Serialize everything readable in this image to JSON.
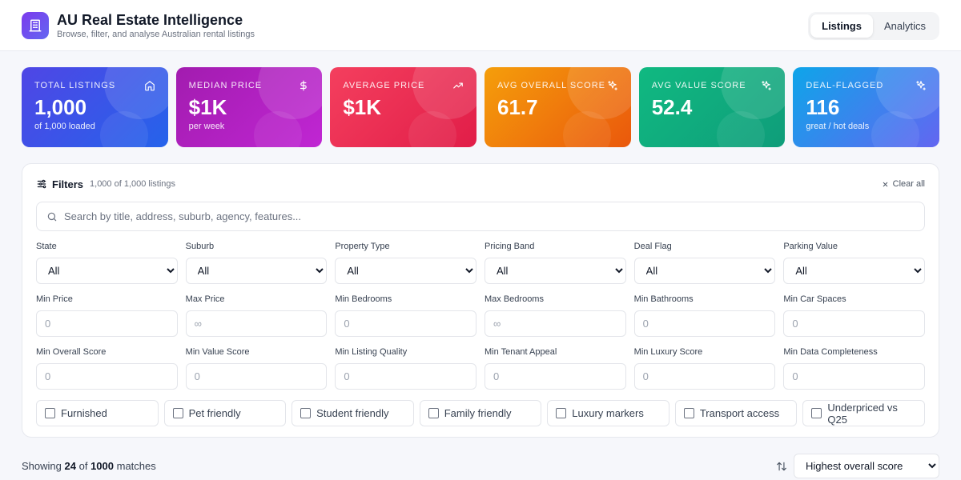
{
  "header": {
    "title": "AU Real Estate Intelligence",
    "subtitle": "Browse, filter, and analyse Australian rental listings",
    "logo_icon": "building-icon",
    "tabs": [
      {
        "label": "Listings",
        "active": true
      },
      {
        "label": "Analytics",
        "active": false
      }
    ]
  },
  "stats": [
    {
      "label": "Total Listings",
      "value": "1,000",
      "sub": "of 1,000 loaded",
      "icon": "home-icon"
    },
    {
      "label": "Median Price",
      "value": "$1K",
      "sub": "per week",
      "icon": "dollar-icon"
    },
    {
      "label": "Average Price",
      "value": "$1K",
      "sub": "",
      "icon": "trending-up-icon"
    },
    {
      "label": "Avg Overall Score",
      "value": "61.7",
      "sub": "",
      "icon": "sparkles-icon"
    },
    {
      "label": "Avg Value Score",
      "value": "52.4",
      "sub": "",
      "icon": "sparkles-icon"
    },
    {
      "label": "Deal-Flagged",
      "value": "116",
      "sub": "great / hot deals",
      "icon": "sparkles-icon"
    }
  ],
  "filters": {
    "title": "Filters",
    "count": "1,000 of 1,000 listings",
    "clear_label": "Clear all",
    "search_placeholder": "Search by title, address, suburb, agency, features...",
    "selects": [
      {
        "label": "State",
        "value": "All"
      },
      {
        "label": "Suburb",
        "value": "All"
      },
      {
        "label": "Property Type",
        "value": "All"
      },
      {
        "label": "Pricing Band",
        "value": "All"
      },
      {
        "label": "Deal Flag",
        "value": "All"
      },
      {
        "label": "Parking Value",
        "value": "All"
      }
    ],
    "numbers": [
      {
        "label": "Min Price",
        "placeholder": "0"
      },
      {
        "label": "Max Price",
        "placeholder": "∞"
      },
      {
        "label": "Min Bedrooms",
        "placeholder": "0"
      },
      {
        "label": "Max Bedrooms",
        "placeholder": "∞"
      },
      {
        "label": "Min Bathrooms",
        "placeholder": "0"
      },
      {
        "label": "Min Car Spaces",
        "placeholder": "0"
      }
    ],
    "scores": [
      {
        "label": "Min Overall Score",
        "placeholder": "0"
      },
      {
        "label": "Min Value Score",
        "placeholder": "0"
      },
      {
        "label": "Min Listing Quality",
        "placeholder": "0"
      },
      {
        "label": "Min Tenant Appeal",
        "placeholder": "0"
      },
      {
        "label": "Min Luxury Score",
        "placeholder": "0"
      },
      {
        "label": "Min Data Completeness",
        "placeholder": "0"
      }
    ],
    "checkboxes": [
      {
        "label": "Furnished"
      },
      {
        "label": "Pet friendly"
      },
      {
        "label": "Student friendly"
      },
      {
        "label": "Family friendly"
      },
      {
        "label": "Luxury markers"
      },
      {
        "label": "Transport access"
      },
      {
        "label": "Underpriced vs Q25"
      }
    ]
  },
  "results": {
    "prefix": "Showing",
    "shown": "24",
    "of": "of",
    "total": "1000",
    "suffix": "matches",
    "sort_value": "Highest overall score"
  }
}
